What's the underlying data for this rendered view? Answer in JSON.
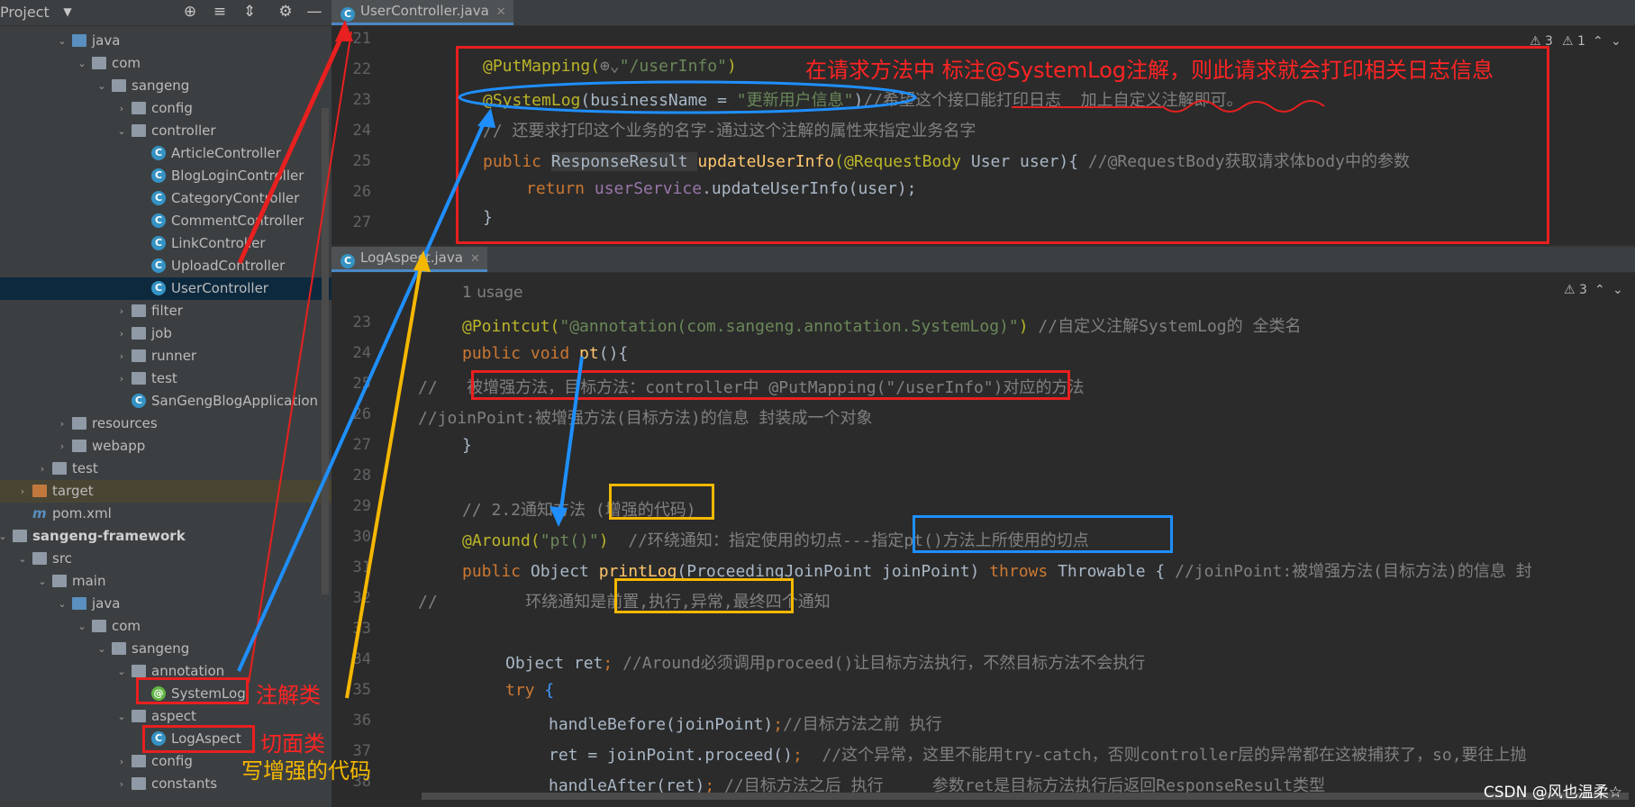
{
  "project_panel": {
    "title": "Project",
    "tree": [
      {
        "label": "java",
        "kind": "folder-src",
        "depth": 3,
        "expanded": true
      },
      {
        "label": "com",
        "kind": "folder",
        "depth": 4,
        "expanded": true
      },
      {
        "label": "sangeng",
        "kind": "folder",
        "depth": 5,
        "expanded": true
      },
      {
        "label": "config",
        "kind": "folder",
        "depth": 6,
        "expanded": false
      },
      {
        "label": "controller",
        "kind": "folder",
        "depth": 6,
        "expanded": true
      },
      {
        "label": "ArticleController",
        "kind": "class",
        "depth": 7
      },
      {
        "label": "BlogLoginController",
        "kind": "class",
        "depth": 7
      },
      {
        "label": "CategoryController",
        "kind": "class",
        "depth": 7
      },
      {
        "label": "CommentController",
        "kind": "class",
        "depth": 7
      },
      {
        "label": "LinkController",
        "kind": "class",
        "depth": 7
      },
      {
        "label": "UploadController",
        "kind": "class",
        "depth": 7
      },
      {
        "label": "UserController",
        "kind": "class",
        "depth": 7,
        "selected": true
      },
      {
        "label": "filter",
        "kind": "folder",
        "depth": 6,
        "expanded": false
      },
      {
        "label": "job",
        "kind": "folder",
        "depth": 6,
        "expanded": false
      },
      {
        "label": "runner",
        "kind": "folder",
        "depth": 6,
        "expanded": false
      },
      {
        "label": "test",
        "kind": "folder",
        "depth": 6,
        "expanded": false
      },
      {
        "label": "SanGengBlogApplication",
        "kind": "app",
        "depth": 6
      },
      {
        "label": "resources",
        "kind": "folder-res",
        "depth": 3,
        "expanded": false
      },
      {
        "label": "webapp",
        "kind": "folder",
        "depth": 3,
        "expanded": false
      },
      {
        "label": "test",
        "kind": "folder",
        "depth": 2,
        "expanded": false
      },
      {
        "label": "target",
        "kind": "folder-orange",
        "depth": 1,
        "expanded": false,
        "highlight": true
      },
      {
        "label": "pom.xml",
        "kind": "maven",
        "depth": 1
      },
      {
        "label": "sangeng-framework",
        "kind": "module",
        "depth": 0,
        "expanded": true,
        "bold": true
      },
      {
        "label": "src",
        "kind": "folder",
        "depth": 1,
        "expanded": true
      },
      {
        "label": "main",
        "kind": "folder",
        "depth": 2,
        "expanded": true
      },
      {
        "label": "java",
        "kind": "folder-src",
        "depth": 3,
        "expanded": true
      },
      {
        "label": "com",
        "kind": "folder",
        "depth": 4,
        "expanded": true
      },
      {
        "label": "sangeng",
        "kind": "folder",
        "depth": 5,
        "expanded": true
      },
      {
        "label": "annotation",
        "kind": "folder",
        "depth": 6,
        "expanded": true
      },
      {
        "label": "SystemLog",
        "kind": "annotation",
        "depth": 7
      },
      {
        "label": "aspect",
        "kind": "folder",
        "depth": 6,
        "expanded": true
      },
      {
        "label": "LogAspect",
        "kind": "class",
        "depth": 7
      },
      {
        "label": "config",
        "kind": "folder",
        "depth": 6,
        "expanded": false
      },
      {
        "label": "constants",
        "kind": "folder",
        "depth": 6,
        "expanded": false
      }
    ]
  },
  "editor_top": {
    "tab": "UserController.java",
    "warnings": "3",
    "errors": "1",
    "lines": [
      {
        "num": "21"
      },
      {
        "num": "22"
      },
      {
        "num": "23"
      },
      {
        "num": "24"
      },
      {
        "num": "25"
      },
      {
        "num": "26"
      },
      {
        "num": "27"
      }
    ],
    "code": {
      "l22_ann": "@PutMapping(",
      "l22_str": "\"/userInfo\"",
      "l22_end": ")",
      "l23_ann": "@SystemLog",
      "l23_mid": "(businessName = ",
      "l23_str": "\"更新用户信息\"",
      "l23_end": ")",
      "l23_cm": "//希望这个接口能打印日志  加上自定义注解即可。",
      "l24_cm": "// 还要求打印这个业务的名字-通过这个注解的属性来指定业务名字",
      "l25_kw": "public ",
      "l25_type": "ResponseResult ",
      "l25_fn": "updateUserInfo",
      "l25_ann": "(@RequestBody ",
      "l25_rest": "User user){ ",
      "l25_cm": "//@RequestBody获取请求体body中的参数",
      "l26_kw": "return ",
      "l26_fld": "userService",
      "l26_rest": ".updateUserInfo(user);",
      "l27": "}"
    },
    "annotation_note": "在请求方法中 标注@SystemLog注解，则此请求就会打印相关日志信息"
  },
  "editor_bottom": {
    "tab": "LogAspect.java",
    "usage": "1 usage",
    "warnings": "3",
    "lines": [
      {
        "num": "23"
      },
      {
        "num": "24"
      },
      {
        "num": "25"
      },
      {
        "num": "26"
      },
      {
        "num": "27"
      },
      {
        "num": "28"
      },
      {
        "num": "29"
      },
      {
        "num": "30"
      },
      {
        "num": "31"
      },
      {
        "num": "32"
      },
      {
        "num": "33"
      },
      {
        "num": "34"
      },
      {
        "num": "35"
      },
      {
        "num": "36"
      },
      {
        "num": "37"
      },
      {
        "num": "38"
      }
    ],
    "code": {
      "l23_ann": "@Pointcut(",
      "l23_str": "\"@annotation(com.sangeng.annotation.SystemLog)\"",
      "l23_end": ") ",
      "l23_cm": "//自定义注解SystemLog的 全类名",
      "l24_kw": "public void ",
      "l24_fn": "pt",
      "l24_end": "(){",
      "l25_cm": "//   被增强方法，目标方法：controller中 @PutMapping(\"/userInfo\")对应的方法",
      "l26_cm": "//joinPoint:被增强方法(目标方法)的信息 封装成一个对象",
      "l27": "}",
      "l29_cm": "// 2.2通知方法 (增强的代码)",
      "l30_ann": "@Around(",
      "l30_str": "\"pt()\"",
      "l30_end": ")  ",
      "l30_cm": "//环绕通知：指定使用的切点---指定pt()方法上所使用的切点",
      "l31_kw": "public ",
      "l31_type": "Object ",
      "l31_fn": "printLog",
      "l31_params": "(ProceedingJoinPoint joinPoint) ",
      "l31_kw2": "throws ",
      "l31_exc": "Throwable { ",
      "l31_cm": "//joinPoint:被增强方法(目标方法)的信息 封",
      "l32_cm": "//         环绕通知是前置,执行,异常,最终四个通知",
      "l34_type": "Object ret",
      "l34_semi": "; ",
      "l34_cm": "//Around必须调用proceed()让目标方法执行，不然目标方法不会执行",
      "l35_kw": "try ",
      "l35_brace": "{",
      "l36_code": "handleBefore(joinPoint)",
      "l36_semi": ";",
      "l36_cm": "//目标方法之前 执行",
      "l37_code": "ret = joinPoint.proceed()",
      "l37_semi": ";  ",
      "l37_cm": "//这个异常，这里不能用try-catch，否则controller层的异常都在这被捕获了，so,要往上抛",
      "l38_code": "handleAfter(ret)",
      "l38_semi": "; ",
      "l38_cm": "//目标方法之后 执行     参数ret是目标方法执行后返回ResponseResult类型"
    }
  },
  "annotations": {
    "annotation_class": "注解类",
    "aspect_class": "切面类",
    "write_enhance_code": "写增强的代码"
  },
  "watermark": "CSDN @风也温柔☆",
  "colors": {
    "red": "#e8201f",
    "yellow": "#f5b800",
    "blue": "#1f8fff"
  }
}
